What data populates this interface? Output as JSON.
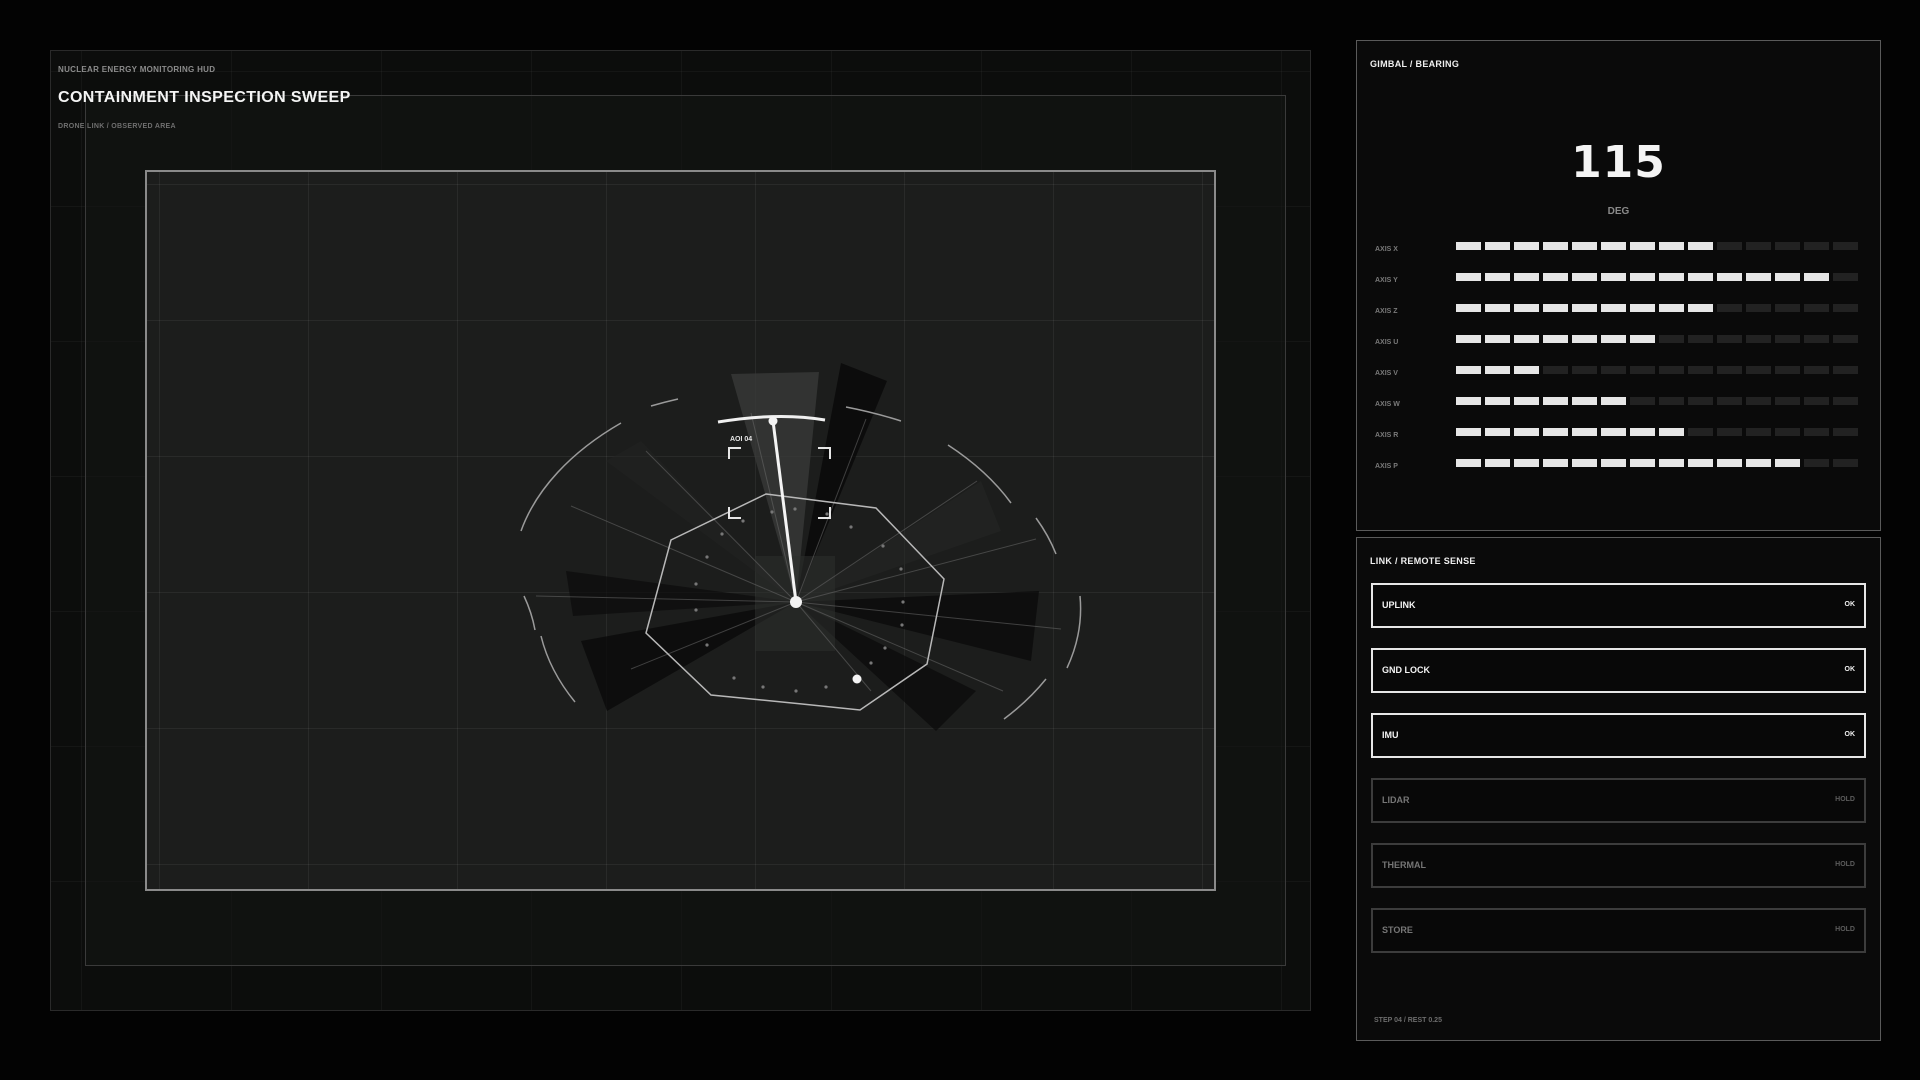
{
  "hud": {
    "kicker": "NUCLEAR ENERGY MONITORING HUD",
    "title": "CONTAINMENT INSPECTION SWEEP",
    "subtitle": "DRONE LINK  /  OBSERVED AREA",
    "target_label": "AOI 04"
  },
  "gimbal": {
    "title": "GIMBAL / BEARING",
    "value": "115",
    "unit": "DEG",
    "segments_total": 14,
    "axes": [
      {
        "label": "AXIS X",
        "level": 9
      },
      {
        "label": "AXIS Y",
        "level": 13
      },
      {
        "label": "AXIS Z",
        "level": 9
      },
      {
        "label": "AXIS U",
        "level": 7
      },
      {
        "label": "AXIS V",
        "level": 3
      },
      {
        "label": "AXIS W",
        "level": 6
      },
      {
        "label": "AXIS R",
        "level": 8
      },
      {
        "label": "AXIS P",
        "level": 12
      }
    ]
  },
  "link": {
    "title": "LINK / REMOTE SENSE",
    "rows": [
      {
        "name": "UPLINK",
        "status": "OK",
        "state": "ok"
      },
      {
        "name": "GND LOCK",
        "status": "OK",
        "state": "ok"
      },
      {
        "name": "IMU",
        "status": "OK",
        "state": "ok"
      },
      {
        "name": "LIDAR",
        "status": "HOLD",
        "state": "hold"
      },
      {
        "name": "THERMAL",
        "status": "HOLD",
        "state": "hold"
      },
      {
        "name": "STORE",
        "status": "HOLD",
        "state": "hold"
      }
    ],
    "footer": "STEP 04 / REST 0.25"
  },
  "colors": {
    "accent": "#e6e6e6",
    "background": "#030303",
    "panel": "#0a0a0a",
    "muted": "#3c3c3c"
  }
}
